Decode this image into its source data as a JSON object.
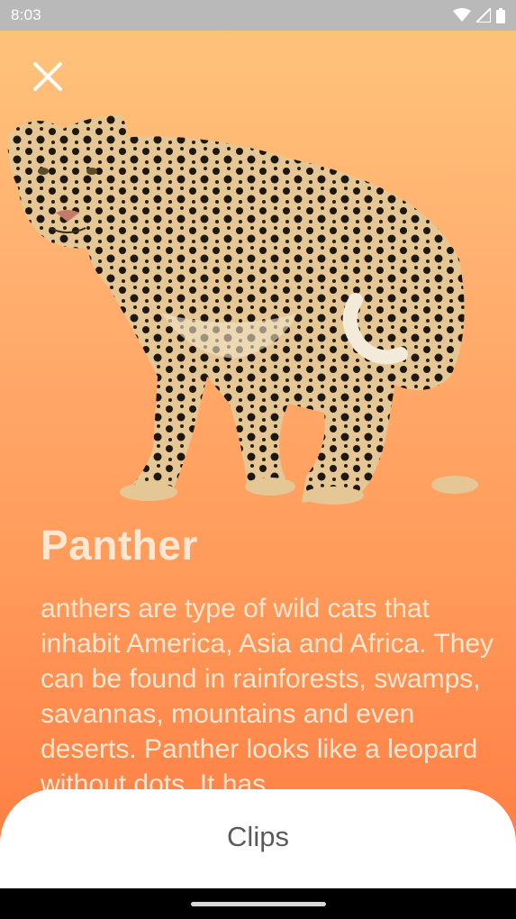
{
  "status_bar": {
    "time": "8:03",
    "icons": [
      "wifi-icon",
      "signal-icon",
      "battery-icon"
    ]
  },
  "header": {
    "close_icon": "close-icon"
  },
  "animal": {
    "image": "leopard-image",
    "name": "Panther",
    "description": "anthers are type of wild cats that inhabit America, Asia and Africa. They can be found in rainforests, swamps, savannas, mountains and even deserts. Panther looks like a leopard without dots. It has"
  },
  "bottom_sheet": {
    "label": "Clips"
  },
  "colors": {
    "gradient_top": "#ffc57c",
    "gradient_bottom": "#ff7a40",
    "text": "#fde7d2",
    "status_bar": "#b9b9b9"
  }
}
